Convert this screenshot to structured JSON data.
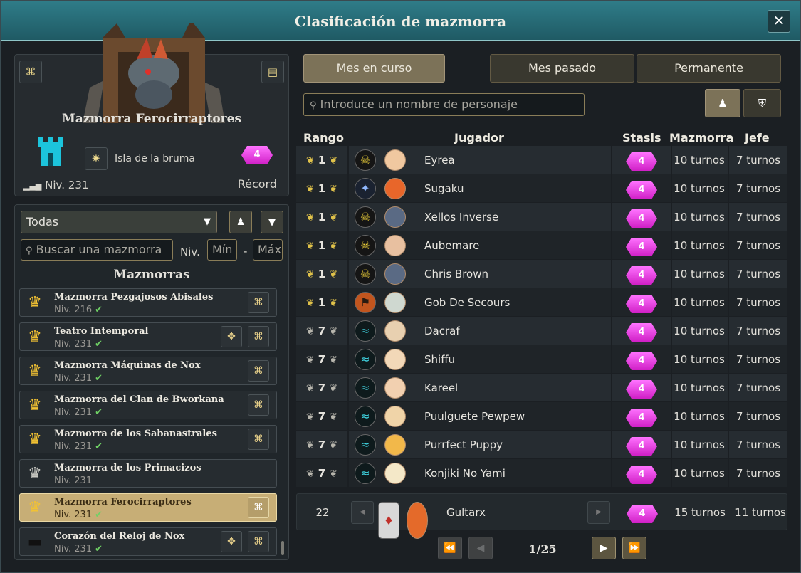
{
  "window": {
    "title": "Clasificación de mazmorra",
    "close_label": "✕"
  },
  "dungeon": {
    "name": "Mazmorra Ferocirraptores",
    "zone": "Isla de la bruma",
    "level": "Niv. 231",
    "record_label": "Récord",
    "stasis": "4"
  },
  "filters": {
    "dropdown_value": "Todas",
    "search_placeholder": "Buscar una mazmorra",
    "level_label": "Niv.",
    "min_placeholder": "Mín",
    "max_placeholder": "Máx",
    "dash": "-"
  },
  "list_title": "Mazmorras",
  "dungeons": [
    {
      "name": "Mazmorra Pezgajosos Abisales",
      "level": "Niv. 216",
      "check": "✔"
    },
    {
      "name": "Teatro Intemporal",
      "level": "Niv. 231",
      "check": "✔"
    },
    {
      "name": "Mazmorra Máquinas de Nox",
      "level": "Niv. 231",
      "check": "✔"
    },
    {
      "name": "Mazmorra del Clan de Bworkana",
      "level": "Niv. 231",
      "check": "✔"
    },
    {
      "name": "Mazmorra de los Sabanastrales",
      "level": "Niv. 231",
      "check": "✔"
    },
    {
      "name": "Mazmorra de los Primacizos",
      "level": "Niv. 231",
      "check": ""
    },
    {
      "name": "Mazmorra Ferocirraptores",
      "level": "Niv. 231",
      "check": "✔"
    },
    {
      "name": "Corazón del Reloj de Nox",
      "level": "Niv. 231",
      "check": "✔"
    }
  ],
  "tabs": [
    "Mes en curso",
    "Mes pasado",
    "Permanente"
  ],
  "player_search_placeholder": "Introduce un nombre de personaje",
  "columns": {
    "rank": "Rango",
    "player": "Jugador",
    "stasis": "Stasis",
    "dungeon": "Mazmorra",
    "boss": "Jefe"
  },
  "rows": [
    {
      "rank": "1",
      "name": "Eyrea",
      "stasis": "4",
      "dungeon": "10 turnos",
      "boss": "7 turnos"
    },
    {
      "rank": "1",
      "name": "Sugaku",
      "stasis": "4",
      "dungeon": "10 turnos",
      "boss": "7 turnos"
    },
    {
      "rank": "1",
      "name": "Xellos Inverse",
      "stasis": "4",
      "dungeon": "10 turnos",
      "boss": "7 turnos"
    },
    {
      "rank": "1",
      "name": "Aubemare",
      "stasis": "4",
      "dungeon": "10 turnos",
      "boss": "7 turnos"
    },
    {
      "rank": "1",
      "name": "Chris Brown",
      "stasis": "4",
      "dungeon": "10 turnos",
      "boss": "7 turnos"
    },
    {
      "rank": "1",
      "name": "Gob De Secours",
      "stasis": "4",
      "dungeon": "10 turnos",
      "boss": "7 turnos"
    },
    {
      "rank": "7",
      "name": "Dacraf",
      "stasis": "4",
      "dungeon": "10 turnos",
      "boss": "7 turnos"
    },
    {
      "rank": "7",
      "name": "Shiffu",
      "stasis": "4",
      "dungeon": "10 turnos",
      "boss": "7 turnos"
    },
    {
      "rank": "7",
      "name": "Kareel",
      "stasis": "4",
      "dungeon": "10 turnos",
      "boss": "7 turnos"
    },
    {
      "rank": "7",
      "name": "Puulguete Pewpew",
      "stasis": "4",
      "dungeon": "10 turnos",
      "boss": "7 turnos"
    },
    {
      "rank": "7",
      "name": "Purrfect Puppy",
      "stasis": "4",
      "dungeon": "10 turnos",
      "boss": "7 turnos"
    },
    {
      "rank": "7",
      "name": "Konjiki No Yami",
      "stasis": "4",
      "dungeon": "10 turnos",
      "boss": "7 turnos"
    }
  ],
  "my_row": {
    "rank": "22",
    "name": "Gultarx",
    "stasis": "4",
    "dungeon": "15 turnos",
    "boss": "11 turnos"
  },
  "pagination": {
    "page": "1/25"
  },
  "colors": {
    "accent": "#c7ae76",
    "title_bar": "#2f7c88",
    "stasis_gem": "#e04be0",
    "check": "#6fd165",
    "gold_crown": "#f2c233"
  }
}
